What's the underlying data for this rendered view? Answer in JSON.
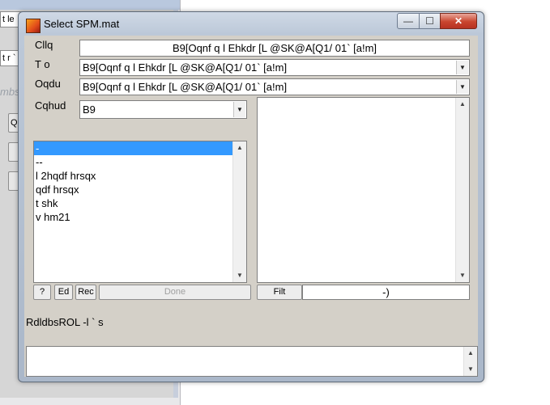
{
  "background_window": {
    "field1_text": "t le",
    "field2_text": "t r `",
    "italic_text": "mbs",
    "button_text": "Q"
  },
  "window": {
    "title": "Select SPM.mat",
    "min_glyph": "—",
    "max_glyph": "☐",
    "close_glyph": "✕"
  },
  "rows": {
    "dir_label": "Cllq",
    "dir_value": "B9[Oqnf q l   Ehkdr [L @SK@A[Q1/ 01` [a!m]",
    "up_label": "T o",
    "up_value": "B9[Oqnf q l   Ehkdr [L @SK@A[Q1/ 01` [a!m]",
    "prev_label": "Oqdu",
    "prev_value": "B9[Oqnf q l   Ehkdr [L @SK@A[Q1/ 01` [a!m]",
    "drive_label": "Cqhud",
    "drive_value": "B9"
  },
  "left_list": {
    "items": [
      "-",
      "--",
      "l  2hqdf hrsqx",
      "qdf hrsqx",
      "t shk",
      "v hm21"
    ],
    "selected_index": 0
  },
  "buttons": {
    "help": "?",
    "ed": "Ed",
    "rec": "Rec",
    "done": "Done",
    "filt": "Filt",
    "filter_value": "-)"
  },
  "status_text": "RdldbsROL -l  ` s",
  "colors": {
    "selection": "#3399ff",
    "client_bg": "#d4d0c8"
  }
}
